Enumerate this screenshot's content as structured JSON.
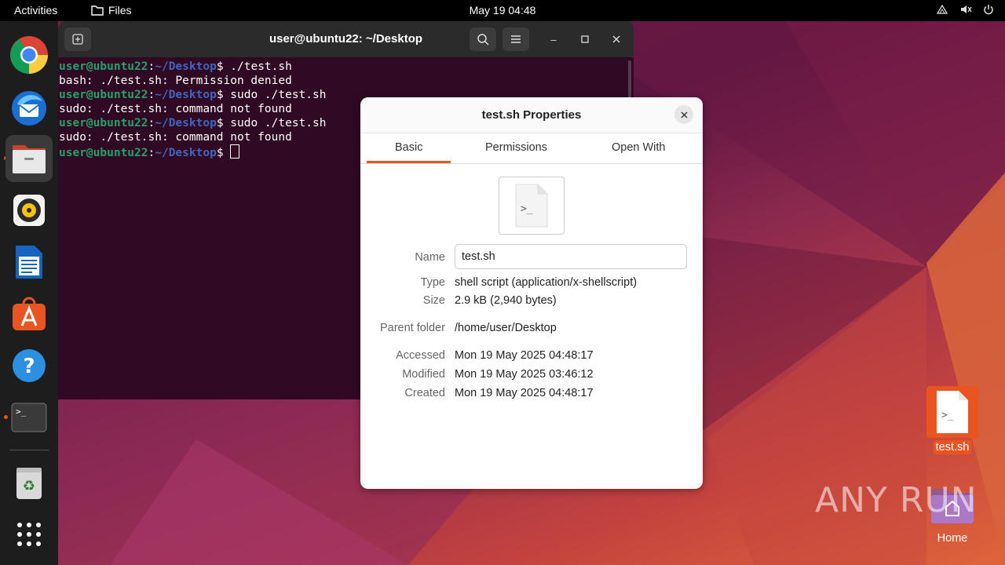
{
  "topbar": {
    "activities": "Activities",
    "app_name": "Files",
    "datetime": "May 19  04:48"
  },
  "dock": {
    "items": [
      {
        "icon": "chrome-icon",
        "running": false
      },
      {
        "icon": "thunderbird-icon",
        "running": false
      },
      {
        "icon": "files-icon",
        "running": true,
        "active": true
      },
      {
        "icon": "rhythmbox-icon",
        "running": false
      },
      {
        "icon": "libreoffice-writer-icon",
        "running": false
      },
      {
        "icon": "app-center-icon",
        "running": false
      },
      {
        "icon": "help-icon",
        "running": false
      },
      {
        "icon": "terminal-icon",
        "running": true
      },
      {
        "icon": "trash-icon",
        "running": false
      },
      {
        "icon": "show-apps-icon",
        "running": false
      }
    ]
  },
  "terminal": {
    "title": "user@ubuntu22: ~/Desktop",
    "prompt_user": "user@ubuntu22",
    "prompt_sep": ":",
    "prompt_path": "~/Desktop",
    "prompt_end": "$ ",
    "lines": [
      {
        "type": "cmd",
        "text": "./test.sh"
      },
      {
        "type": "out",
        "text": "bash: ./test.sh: Permission denied"
      },
      {
        "type": "cmd",
        "text": "sudo ./test.sh"
      },
      {
        "type": "out",
        "text": "sudo: ./test.sh: command not found"
      },
      {
        "type": "cmd",
        "text": "sudo ./test.sh"
      },
      {
        "type": "out",
        "text": "sudo: ./test.sh: command not found"
      },
      {
        "type": "cmd",
        "text": ""
      }
    ]
  },
  "dialog": {
    "title": "test.sh Properties",
    "tabs": [
      "Basic",
      "Permissions",
      "Open With"
    ],
    "active_tab": "Basic",
    "file_glyph": ">_",
    "name_label": "Name",
    "name_value": "test.sh",
    "type_label": "Type",
    "type_value": "shell script (application/x-shellscript)",
    "size_label": "Size",
    "size_value": "2.9 kB (2,940 bytes)",
    "parent_label": "Parent folder",
    "parent_value": "/home/user/Desktop",
    "accessed_label": "Accessed",
    "accessed_value": "Mon 19 May 2025 04:48:17",
    "modified_label": "Modified",
    "modified_value": "Mon 19 May 2025 03:46:12",
    "created_label": "Created",
    "created_value": "Mon 19 May 2025 04:48:17"
  },
  "desktop": {
    "icons": [
      {
        "label": "test.sh",
        "icon": "script-file-icon",
        "selected": true
      },
      {
        "label": "Home",
        "icon": "home-folder-icon",
        "selected": false
      }
    ]
  },
  "watermark": "ANY RUN",
  "colors": {
    "accent": "#e95420",
    "terminal_bg": "#300a24",
    "prompt_user": "#26a269",
    "prompt_path": "#3f66c0"
  }
}
